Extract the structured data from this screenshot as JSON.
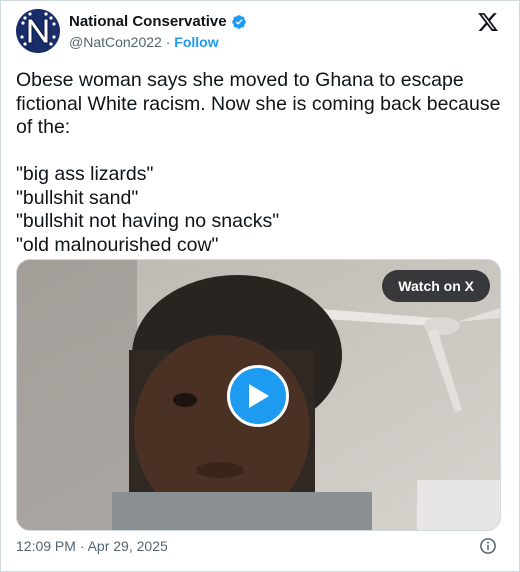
{
  "author": {
    "name": "National Conservative",
    "handle": "@NatCon2022",
    "separator": " · ",
    "follow_label": "Follow",
    "avatar_icon": "natcon-logo-icon",
    "verified_icon": "verified-badge-icon"
  },
  "platform_icon": "x-logo-icon",
  "tweet": {
    "text": "Obese woman says she moved to Ghana to escape fictional White racism. Now she is coming back because of the:\n\n\"big ass lizards\"\n\"bullshit sand\"\n\"bullshit not having no snacks\"\n\"old malnourished cow\""
  },
  "media": {
    "watch_label": "Watch on X",
    "play_icon": "play-icon"
  },
  "footer": {
    "timestamp": "12:09 PM · Apr 29, 2025",
    "info_icon": "info-icon"
  },
  "colors": {
    "accent": "#1d9bf0",
    "text": "#0f1419",
    "muted": "#536471",
    "border": "#cfd9de"
  }
}
